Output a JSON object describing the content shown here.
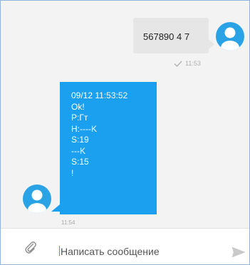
{
  "outgoing_message": {
    "text": "567890 4 7",
    "time": "11:53"
  },
  "incoming_message": {
    "lines": [
      "09/12 11:53:52",
      "Ok!",
      "P:Гт",
      "H:----K",
      "S:19",
      "---K",
      "S:15",
      "!"
    ],
    "time": "11:54"
  },
  "input_bar": {
    "placeholder": "Написать сообщение"
  },
  "colors": {
    "accent": "#1aa0ef",
    "avatar": "#2aa3e6",
    "outgoing_bubble": "#e6e6e6",
    "chat_background": "#f3f3f3"
  },
  "icons": {
    "attach": "paperclip-icon",
    "send": "send-arrow-icon",
    "delivered": "checkmark-icon",
    "avatar": "user-avatar-icon"
  }
}
